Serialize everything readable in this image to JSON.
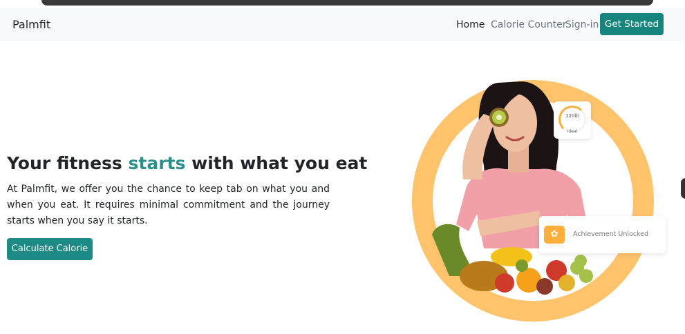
{
  "navbar": {
    "brand": "Palmfit",
    "links": [
      "Home",
      "Calorie Counter",
      "Sign-in"
    ],
    "cta": "Get Started"
  },
  "hero": {
    "title_before": "Your fitness ",
    "title_accent": "starts",
    "title_after": " with what you eat",
    "description": "At Palmfit, we offer you the chance to keep tab on what you and when you eat. It requires minimal commitment and the journey starts when you say it starts.",
    "button": "Calculate Calorie"
  },
  "weight_card": {
    "value": "120lb",
    "label": "Ideal"
  },
  "achievement_card": {
    "icon": "medal-icon",
    "text": "Achievement Unlocked"
  },
  "colors": {
    "accent": "#17847e",
    "ring": "#fec36b",
    "badge": "#fdae3b"
  }
}
